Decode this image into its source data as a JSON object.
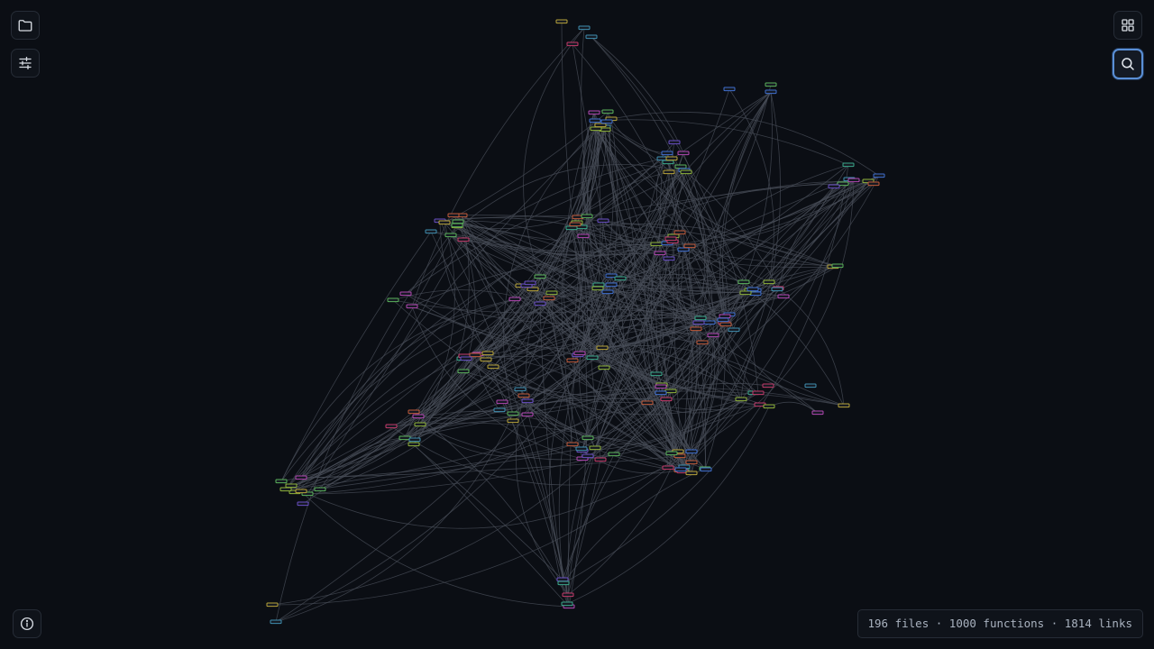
{
  "status_bar": {
    "text": "196 files · 1000 functions · 1814 links"
  },
  "toolbar": {
    "left_top_icon": "folder-icon",
    "left_second_icon": "sliders-icon",
    "right_top_icon": "grid-icon",
    "right_second_icon": "search-icon",
    "bottom_left_icon": "info-icon"
  },
  "graph": {
    "link_color": "#4a4f5a",
    "node_colors": [
      "#5bb35b",
      "#b347b3",
      "#3f8fb0",
      "#c05a3a",
      "#b8a43a",
      "#6a4fc4",
      "#3aa88a",
      "#c43a6a",
      "#3f6fcf",
      "#8fb33a"
    ],
    "node_fill": "#151922"
  }
}
